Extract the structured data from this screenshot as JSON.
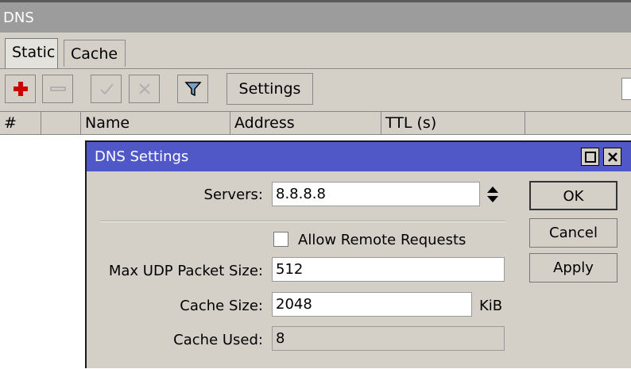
{
  "window": {
    "title": "DNS"
  },
  "tabs": [
    {
      "label": "Static",
      "active": true
    },
    {
      "label": "Cache",
      "active": false
    }
  ],
  "toolbar": {
    "add_icon": "plus-icon",
    "remove_icon": "minus-icon",
    "enable_icon": "check-icon",
    "disable_icon": "x-icon",
    "filter_icon": "filter-icon",
    "settings_label": "Settings"
  },
  "table": {
    "columns": [
      "#",
      "",
      "Name",
      "Address",
      "TTL (s)",
      ""
    ]
  },
  "dialog": {
    "title": "DNS Settings",
    "servers": {
      "label": "Servers:",
      "value": "8.8.8.8"
    },
    "allow_remote": {
      "label": "Allow Remote Requests",
      "checked": false
    },
    "max_udp": {
      "label": "Max UDP Packet Size:",
      "value": "512"
    },
    "cache_size": {
      "label": "Cache Size:",
      "value": "2048",
      "unit": "KiB"
    },
    "cache_used": {
      "label": "Cache Used:",
      "value": "8"
    },
    "buttons": {
      "ok": "OK",
      "cancel": "Cancel",
      "apply": "Apply"
    }
  },
  "colors": {
    "dialog_title_bg": "#5058c8",
    "window_title_bg": "#9c9c9c",
    "add_icon": "#cc0000"
  }
}
